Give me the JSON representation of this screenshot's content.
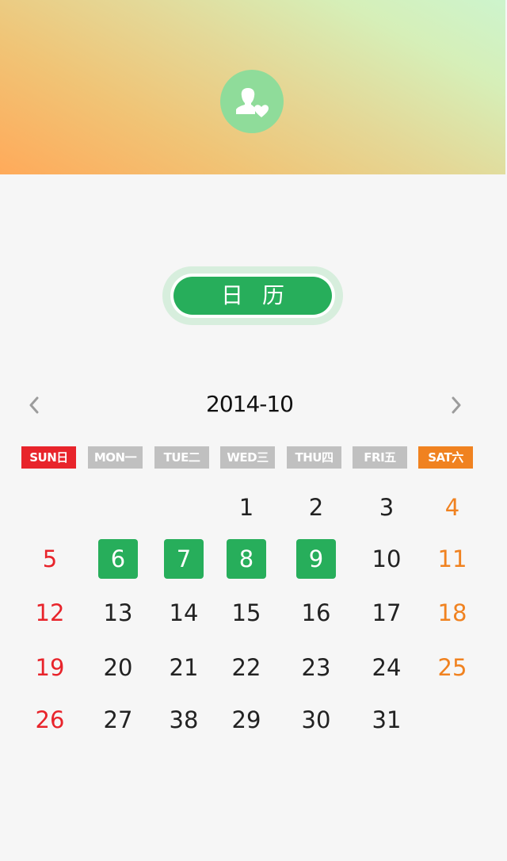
{
  "header": {
    "avatar_icon": "user-heart-icon"
  },
  "title": {
    "label": "日历"
  },
  "calendar": {
    "month_label": "2014-10",
    "prev_icon": "chevron-left-icon",
    "next_icon": "chevron-right-icon",
    "weekdays": [
      {
        "label": "SUN日",
        "color": "#e8242b"
      },
      {
        "label": "MON一",
        "color": "#c0c0c0"
      },
      {
        "label": "TUE二",
        "color": "#c0c0c0"
      },
      {
        "label": "WED三",
        "color": "#c0c0c0"
      },
      {
        "label": "THU四",
        "color": "#c0c0c0"
      },
      {
        "label": "FRI五",
        "color": "#c0c0c0"
      },
      {
        "label": "SAT六",
        "color": "#f08220"
      }
    ],
    "weeks": [
      [
        "",
        "",
        "",
        "1",
        "2",
        "3",
        "4"
      ],
      [
        "5",
        "6",
        "7",
        "8",
        "9",
        "10",
        "11"
      ],
      [
        "12",
        "13",
        "14",
        "15",
        "16",
        "17",
        "18"
      ],
      [
        "19",
        "20",
        "21",
        "22",
        "23",
        "24",
        "25"
      ],
      [
        "26",
        "27",
        "38",
        "29",
        "30",
        "31",
        ""
      ]
    ],
    "selected_days": [
      "6",
      "7",
      "8",
      "9"
    ],
    "colors": {
      "accent": "#27ae5b",
      "sunday": "#e8242b",
      "saturday": "#f08220",
      "weekday_badge": "#c0c0c0"
    }
  }
}
